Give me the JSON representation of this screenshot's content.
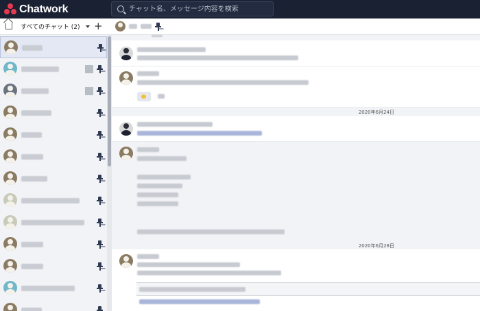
{
  "header": {
    "app_name": "Chatwork",
    "search_placeholder": "チャット名、メッセージ内容を検索"
  },
  "subbar": {
    "filter_label": "すべてのチャット (2)",
    "add_label": "+"
  },
  "timeline": {
    "dates": [
      "2020年6月24日",
      "2020年6月28日"
    ]
  },
  "colors": {
    "header_bg": "#1a2133",
    "logo_accent": "#e8384f",
    "pin": "#2f3a52"
  }
}
